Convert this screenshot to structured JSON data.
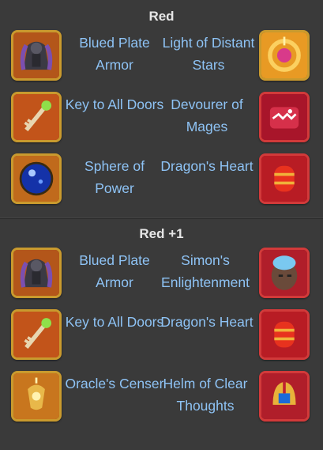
{
  "sections": [
    {
      "title": "Red",
      "rows": [
        {
          "left_label": "Blued Plate Armor",
          "right_label": "Light of Distant Stars",
          "left_icon": "armor-icon",
          "right_icon": "amulet-icon"
        },
        {
          "left_label": "Key to All Doors",
          "right_label": "Devourer of Mages",
          "left_icon": "key-icon",
          "right_icon": "monster-chest-icon"
        },
        {
          "left_label": "Sphere of Power",
          "right_label": "Dragon's Heart",
          "left_icon": "orb-icon",
          "right_icon": "heart-icon"
        }
      ]
    },
    {
      "title": "Red +1",
      "rows": [
        {
          "left_label": "Blued Plate Armor",
          "right_label": "Simon's Enlightenment",
          "left_icon": "armor-icon",
          "right_icon": "face-icon"
        },
        {
          "left_label": "Key to All Doors",
          "right_label": "Dragon's Heart",
          "left_icon": "key-icon",
          "right_icon": "heart-icon"
        },
        {
          "left_label": "Oracle's Censer",
          "right_label": "Helm of Clear Thoughts",
          "left_icon": "censer-icon",
          "right_icon": "helm-icon"
        }
      ]
    }
  ],
  "colors": {
    "background": "#3a3a3a",
    "title": "#e6e6e6",
    "label": "#8ec3f5",
    "gold_frame": "#c99a2e",
    "red_frame": "#d23a3a"
  }
}
